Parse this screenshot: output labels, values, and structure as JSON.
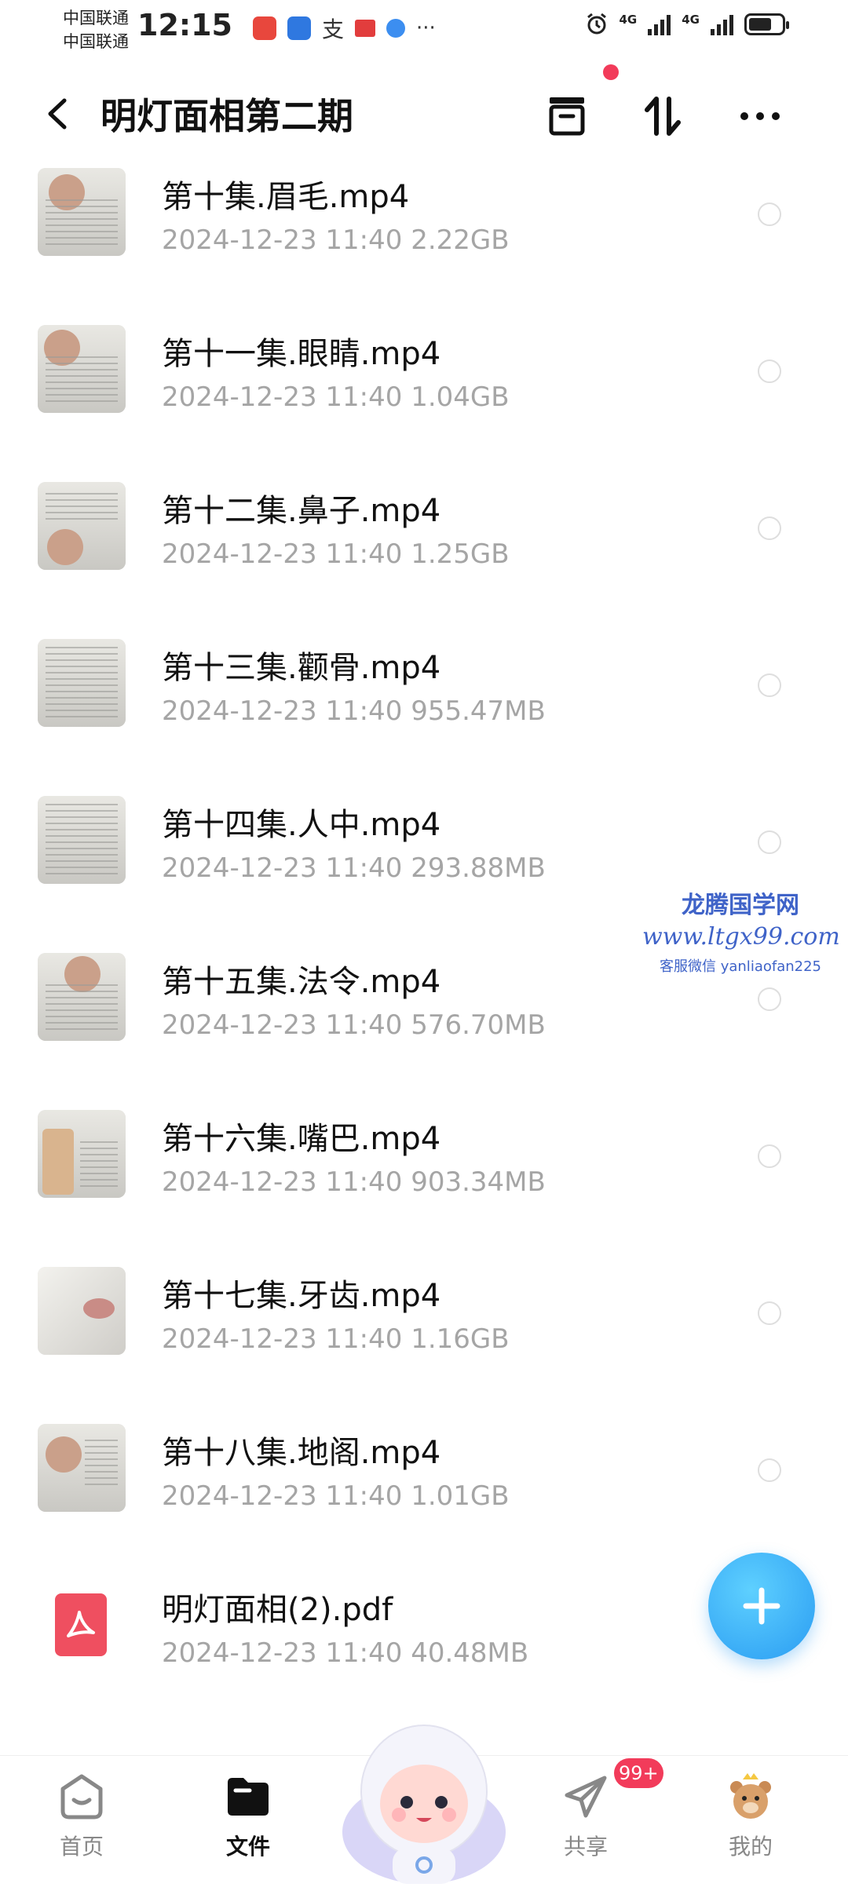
{
  "status_bar": {
    "carrier_1": "中国联通",
    "carrier_2": "中国联通",
    "time": "12:15",
    "net_1": "4G",
    "net_2": "4G"
  },
  "header": {
    "title": "明灯面相第二期"
  },
  "files": [
    {
      "name": "第十集.眉毛.mp4",
      "date": "2024-12-23",
      "time": "11:40",
      "size": "2.22GB"
    },
    {
      "name": "第十一集.眼睛.mp4",
      "date": "2024-12-23",
      "time": "11:40",
      "size": "1.04GB"
    },
    {
      "name": "第十二集.鼻子.mp4",
      "date": "2024-12-23",
      "time": "11:40",
      "size": "1.25GB"
    },
    {
      "name": "第十三集.颧骨.mp4",
      "date": "2024-12-23",
      "time": "11:40",
      "size": "955.47MB"
    },
    {
      "name": "第十四集.人中.mp4",
      "date": "2024-12-23",
      "time": "11:40",
      "size": "293.88MB"
    },
    {
      "name": "第十五集.法令.mp4",
      "date": "2024-12-23",
      "time": "11:40",
      "size": "576.70MB"
    },
    {
      "name": "第十六集.嘴巴.mp4",
      "date": "2024-12-23",
      "time": "11:40",
      "size": "903.34MB"
    },
    {
      "name": "第十七集.牙齿.mp4",
      "date": "2024-12-23",
      "time": "11:40",
      "size": "1.16GB"
    },
    {
      "name": "第十八集.地阁.mp4",
      "date": "2024-12-23",
      "time": "11:40",
      "size": "1.01GB"
    },
    {
      "name": "明灯面相(2).pdf",
      "date": "2024-12-23",
      "time": "11:40",
      "size": "40.48MB"
    }
  ],
  "watermark": {
    "line1": "龙腾国学网",
    "line2": "www.ltgx99.com",
    "line3": "客服微信 yanliaofan225"
  },
  "bottom_nav": {
    "home": "首页",
    "files": "文件",
    "share": "共享",
    "share_badge": "99+",
    "mine": "我的"
  },
  "colors": {
    "accent": "#2a9cf2",
    "badge": "#f23b5a",
    "meta_text": "#a5a5a5",
    "watermark": "#3f63c8"
  }
}
